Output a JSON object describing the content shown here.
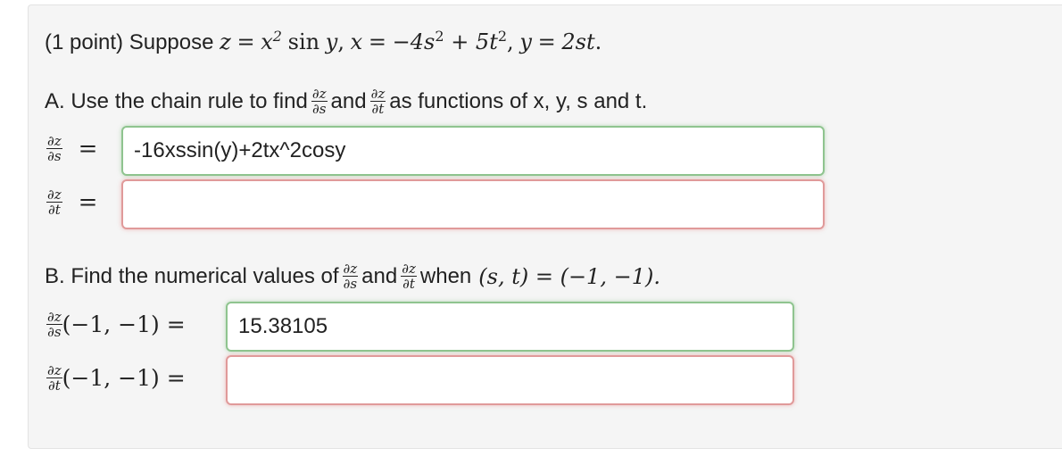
{
  "header": {
    "points": "(1 point)",
    "suppose": "Suppose",
    "z": "z",
    "eq": "=",
    "x": "x",
    "sq": "2",
    "sin": "sin",
    "y": "y",
    "comma": ",",
    "minus4s": "−4s",
    "plus5t": "+ 5t",
    "twoSt": "2st",
    "period": "."
  },
  "partA": {
    "label": "A. Use the chain rule to find",
    "and": "and",
    "tail": "as functions of x, y, s and t.",
    "dz": "∂z",
    "ds": "∂s",
    "dt": "∂t",
    "answer_ds": "-16xssin(y)+2tx^2cosy",
    "answer_dt": ""
  },
  "partB": {
    "label": "B. Find the numerical values of",
    "and": "and",
    "when": "when",
    "point_expr": "(s, t) = (−1, −1).",
    "args": "(−1, −1) =",
    "answer_ds": "15.38105",
    "answer_dt": ""
  }
}
